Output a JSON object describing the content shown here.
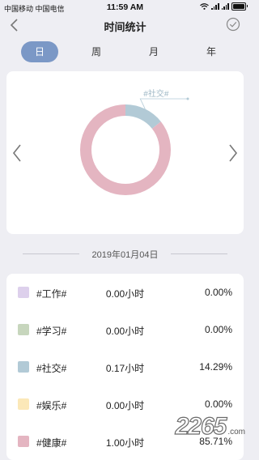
{
  "status_bar": {
    "carriers": "中国移动  中国电信",
    "time": "11:59 AM"
  },
  "header": {
    "title": "时间统计"
  },
  "tabs": [
    {
      "label": "日",
      "active": true
    },
    {
      "label": "周",
      "active": false
    },
    {
      "label": "月",
      "active": false
    },
    {
      "label": "年",
      "active": false
    }
  ],
  "chart": {
    "callout_label": "#社交#"
  },
  "chart_data": {
    "type": "pie",
    "style": "donut",
    "categories": [
      "#工作#",
      "#学习#",
      "#社交#",
      "#娱乐#",
      "#健康#"
    ],
    "values": [
      0.0,
      0.0,
      14.29,
      0.0,
      85.71
    ],
    "colors": [
      "#ddd0ec",
      "#c7d6bd",
      "#b2cad6",
      "#fbe8b8",
      "#e4b5c1"
    ],
    "annotations": [
      "#社交#"
    ]
  },
  "date_label": "2019年01月04日",
  "rows": [
    {
      "tag": "#工作#",
      "hours": "0.00小时",
      "percent": "0.00%",
      "color": "#ddd0ec"
    },
    {
      "tag": "#学习#",
      "hours": "0.00小时",
      "percent": "0.00%",
      "color": "#c7d6bd"
    },
    {
      "tag": "#社交#",
      "hours": "0.17小时",
      "percent": "14.29%",
      "color": "#b2cad6"
    },
    {
      "tag": "#娱乐#",
      "hours": "0.00小时",
      "percent": "0.00%",
      "color": "#fbe8b8"
    },
    {
      "tag": "#健康#",
      "hours": "1.00小时",
      "percent": "85.71%",
      "color": "#e4b5c1"
    }
  ],
  "watermark": {
    "number": "2265",
    "suffix": ".com"
  }
}
